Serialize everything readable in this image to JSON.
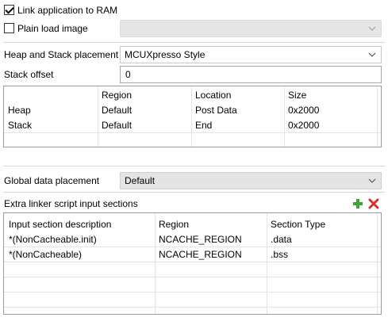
{
  "link_to_ram": {
    "label": "Link application to RAM",
    "checked": true
  },
  "plain_load": {
    "label": "Plain load image",
    "checked": false,
    "value": ""
  },
  "heap_stack": {
    "label": "Heap and Stack placement",
    "value": "MCUXpresso Style"
  },
  "stack_offset": {
    "label": "Stack offset",
    "value": "0"
  },
  "heap_table": {
    "columns": [
      "",
      "Region",
      "Location",
      "Size"
    ],
    "rows": [
      [
        "Heap",
        "Default",
        "Post Data",
        "0x2000"
      ],
      [
        "Stack",
        "Default",
        "End",
        "0x2000"
      ]
    ]
  },
  "global_data": {
    "label": "Global data placement",
    "value": "Default"
  },
  "extra_sections": {
    "label": "Extra linker script input sections",
    "columns": [
      "Input section description",
      "Region",
      "Section Type"
    ],
    "rows": [
      [
        "*(NonCacheable.init)",
        "NCACHE_REGION",
        ".data"
      ],
      [
        "*(NonCacheable)",
        "NCACHE_REGION",
        ".bss"
      ]
    ],
    "add_icon": "green-plus-icon",
    "remove_icon": "red-x-icon",
    "add_color": "#3fa535",
    "remove_color": "#d9302c"
  }
}
